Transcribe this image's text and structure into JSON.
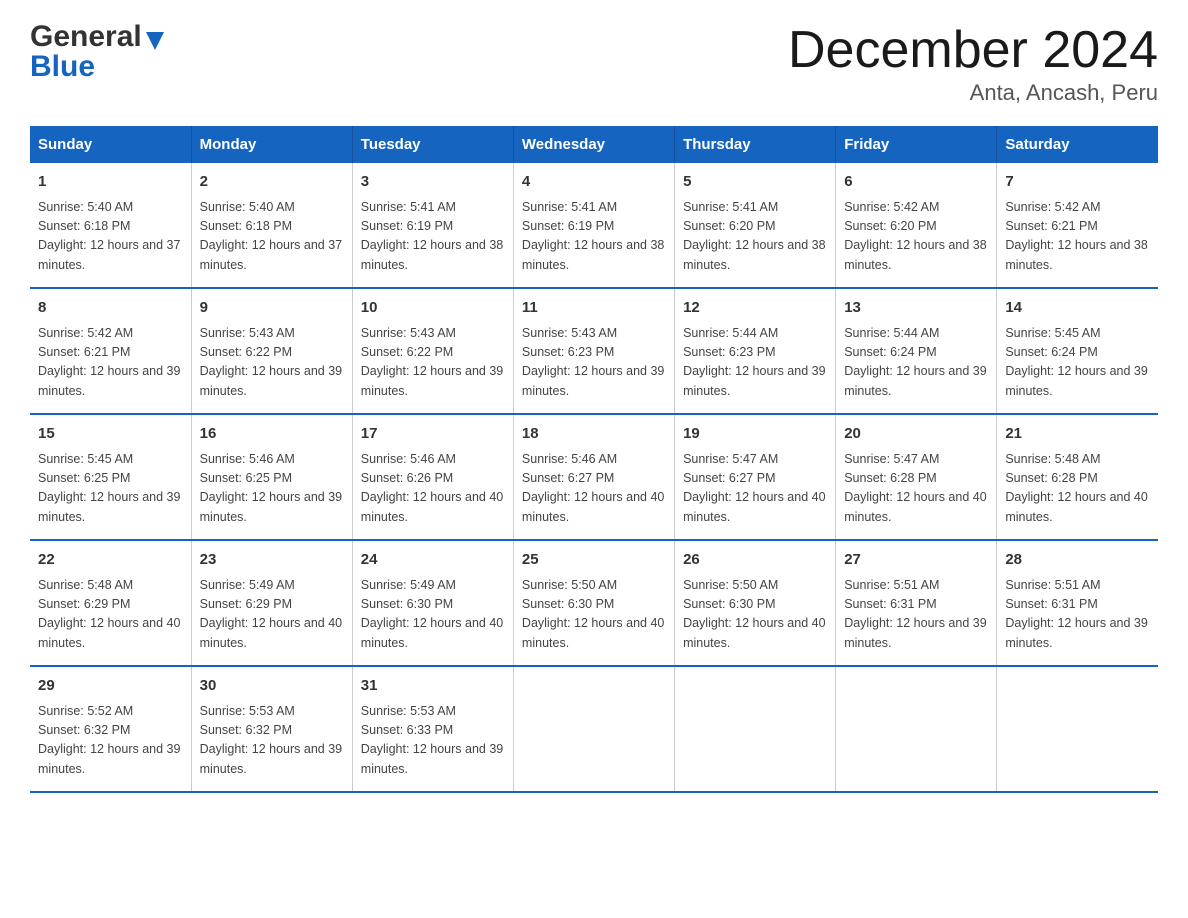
{
  "header": {
    "logo_line1": "General",
    "logo_line2": "Blue",
    "title": "December 2024",
    "subtitle": "Anta, Ancash, Peru"
  },
  "days_of_week": [
    "Sunday",
    "Monday",
    "Tuesday",
    "Wednesday",
    "Thursday",
    "Friday",
    "Saturday"
  ],
  "weeks": [
    [
      {
        "day": "1",
        "sunrise": "5:40 AM",
        "sunset": "6:18 PM",
        "daylight": "12 hours and 37 minutes."
      },
      {
        "day": "2",
        "sunrise": "5:40 AM",
        "sunset": "6:18 PM",
        "daylight": "12 hours and 37 minutes."
      },
      {
        "day": "3",
        "sunrise": "5:41 AM",
        "sunset": "6:19 PM",
        "daylight": "12 hours and 38 minutes."
      },
      {
        "day": "4",
        "sunrise": "5:41 AM",
        "sunset": "6:19 PM",
        "daylight": "12 hours and 38 minutes."
      },
      {
        "day": "5",
        "sunrise": "5:41 AM",
        "sunset": "6:20 PM",
        "daylight": "12 hours and 38 minutes."
      },
      {
        "day": "6",
        "sunrise": "5:42 AM",
        "sunset": "6:20 PM",
        "daylight": "12 hours and 38 minutes."
      },
      {
        "day": "7",
        "sunrise": "5:42 AM",
        "sunset": "6:21 PM",
        "daylight": "12 hours and 38 minutes."
      }
    ],
    [
      {
        "day": "8",
        "sunrise": "5:42 AM",
        "sunset": "6:21 PM",
        "daylight": "12 hours and 39 minutes."
      },
      {
        "day": "9",
        "sunrise": "5:43 AM",
        "sunset": "6:22 PM",
        "daylight": "12 hours and 39 minutes."
      },
      {
        "day": "10",
        "sunrise": "5:43 AM",
        "sunset": "6:22 PM",
        "daylight": "12 hours and 39 minutes."
      },
      {
        "day": "11",
        "sunrise": "5:43 AM",
        "sunset": "6:23 PM",
        "daylight": "12 hours and 39 minutes."
      },
      {
        "day": "12",
        "sunrise": "5:44 AM",
        "sunset": "6:23 PM",
        "daylight": "12 hours and 39 minutes."
      },
      {
        "day": "13",
        "sunrise": "5:44 AM",
        "sunset": "6:24 PM",
        "daylight": "12 hours and 39 minutes."
      },
      {
        "day": "14",
        "sunrise": "5:45 AM",
        "sunset": "6:24 PM",
        "daylight": "12 hours and 39 minutes."
      }
    ],
    [
      {
        "day": "15",
        "sunrise": "5:45 AM",
        "sunset": "6:25 PM",
        "daylight": "12 hours and 39 minutes."
      },
      {
        "day": "16",
        "sunrise": "5:46 AM",
        "sunset": "6:25 PM",
        "daylight": "12 hours and 39 minutes."
      },
      {
        "day": "17",
        "sunrise": "5:46 AM",
        "sunset": "6:26 PM",
        "daylight": "12 hours and 40 minutes."
      },
      {
        "day": "18",
        "sunrise": "5:46 AM",
        "sunset": "6:27 PM",
        "daylight": "12 hours and 40 minutes."
      },
      {
        "day": "19",
        "sunrise": "5:47 AM",
        "sunset": "6:27 PM",
        "daylight": "12 hours and 40 minutes."
      },
      {
        "day": "20",
        "sunrise": "5:47 AM",
        "sunset": "6:28 PM",
        "daylight": "12 hours and 40 minutes."
      },
      {
        "day": "21",
        "sunrise": "5:48 AM",
        "sunset": "6:28 PM",
        "daylight": "12 hours and 40 minutes."
      }
    ],
    [
      {
        "day": "22",
        "sunrise": "5:48 AM",
        "sunset": "6:29 PM",
        "daylight": "12 hours and 40 minutes."
      },
      {
        "day": "23",
        "sunrise": "5:49 AM",
        "sunset": "6:29 PM",
        "daylight": "12 hours and 40 minutes."
      },
      {
        "day": "24",
        "sunrise": "5:49 AM",
        "sunset": "6:30 PM",
        "daylight": "12 hours and 40 minutes."
      },
      {
        "day": "25",
        "sunrise": "5:50 AM",
        "sunset": "6:30 PM",
        "daylight": "12 hours and 40 minutes."
      },
      {
        "day": "26",
        "sunrise": "5:50 AM",
        "sunset": "6:30 PM",
        "daylight": "12 hours and 40 minutes."
      },
      {
        "day": "27",
        "sunrise": "5:51 AM",
        "sunset": "6:31 PM",
        "daylight": "12 hours and 39 minutes."
      },
      {
        "day": "28",
        "sunrise": "5:51 AM",
        "sunset": "6:31 PM",
        "daylight": "12 hours and 39 minutes."
      }
    ],
    [
      {
        "day": "29",
        "sunrise": "5:52 AM",
        "sunset": "6:32 PM",
        "daylight": "12 hours and 39 minutes."
      },
      {
        "day": "30",
        "sunrise": "5:53 AM",
        "sunset": "6:32 PM",
        "daylight": "12 hours and 39 minutes."
      },
      {
        "day": "31",
        "sunrise": "5:53 AM",
        "sunset": "6:33 PM",
        "daylight": "12 hours and 39 minutes."
      },
      null,
      null,
      null,
      null
    ]
  ]
}
